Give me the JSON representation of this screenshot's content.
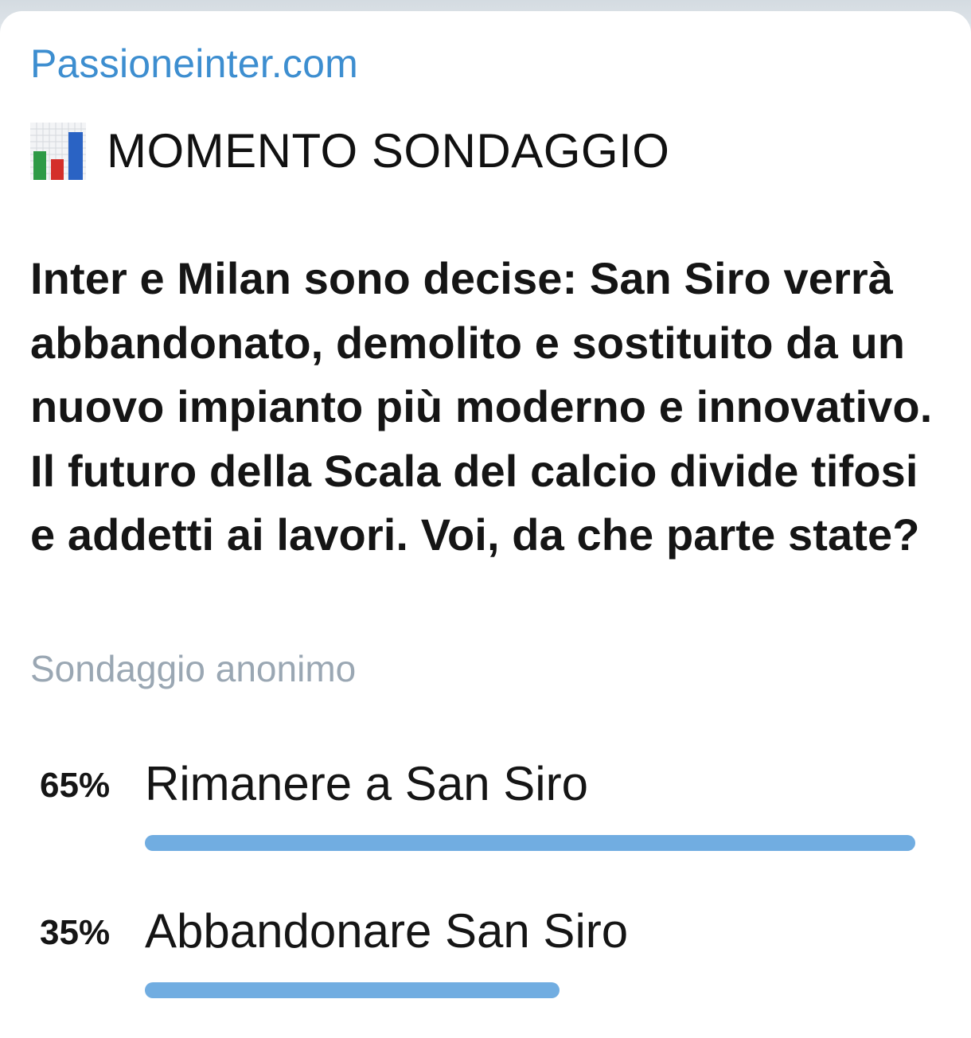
{
  "post": {
    "channel_name": "Passioneinter.com",
    "headline_icon": "bar-chart-icon",
    "headline": "MOMENTO SONDAGGIO",
    "question": "Inter e Milan sono decise: San Siro verrà abbandonato, demolito e sostituito da un nuovo impianto più moderno e innovativo.   Il futuro della Scala del calcio divide tifosi e addetti ai lavori. Voi, da che parte state?",
    "poll_type": "Sondaggio anonimo",
    "options": [
      {
        "percent_label": "65%",
        "label": "Rimanere a San Siro",
        "percent": 65
      },
      {
        "percent_label": "35%",
        "label": "Abbandonare San Siro",
        "percent": 35
      }
    ]
  },
  "colors": {
    "channel_name": "#3d8ed0",
    "bar": "#71ade1",
    "muted": "#9aa7b3"
  }
}
